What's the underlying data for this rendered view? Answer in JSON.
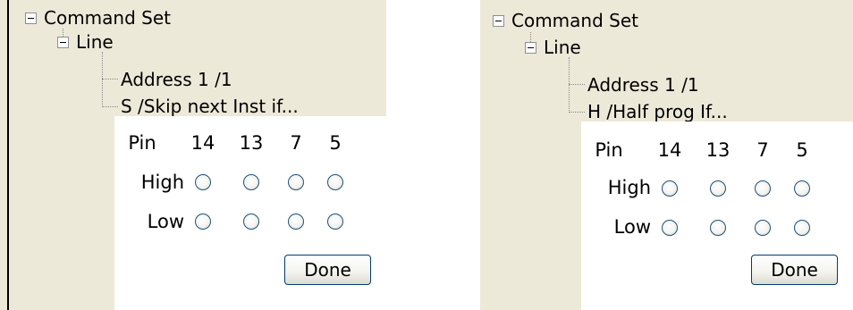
{
  "panels": [
    {
      "root_label": "Command Set",
      "line_label": "Line",
      "address_label": "Address 1 /1",
      "instruction_label": "S /Skip next Inst if...",
      "popup": {
        "pin_header": "Pin",
        "pins": [
          "14",
          "13",
          "7",
          "5"
        ],
        "rows": [
          "High",
          "Low"
        ],
        "done_label": "Done"
      }
    },
    {
      "root_label": "Command Set",
      "line_label": "Line",
      "address_label": "Address 1 /1",
      "instruction_label": "H /Half prog If...",
      "popup": {
        "pin_header": "Pin",
        "pins": [
          "14",
          "13",
          "7",
          "5"
        ],
        "rows": [
          "High",
          "Low"
        ],
        "done_label": "Done"
      }
    }
  ]
}
